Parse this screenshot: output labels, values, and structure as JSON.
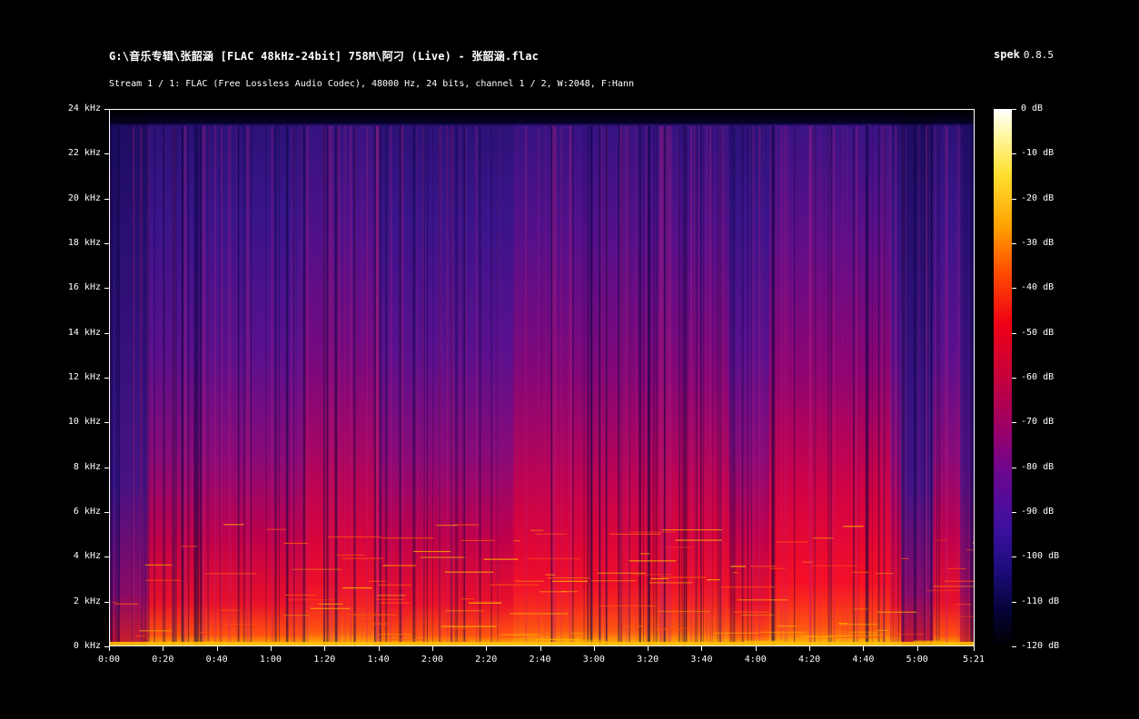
{
  "header": {
    "file_title": "G:\\音乐专辑\\张韶涵 [FLAC 48kHz-24bit] 758M\\阿刁 (Live) - 张韶涵.flac",
    "app_name": "spek",
    "app_version": "0.8.5",
    "stream_info": "Stream 1 / 1: FLAC (Free Lossless Audio Codec), 48000 Hz, 24 bits, channel 1 / 2, W:2048, F:Hann"
  },
  "spectrogram": {
    "frequency_axis": {
      "labels": [
        "0 kHz",
        "2 kHz",
        "4 kHz",
        "6 kHz",
        "8 kHz",
        "10 kHz",
        "12 kHz",
        "14 kHz",
        "16 kHz",
        "18 kHz",
        "20 kHz",
        "22 kHz",
        "24 kHz"
      ],
      "min_khz": 0,
      "max_khz": 24
    },
    "time_axis": {
      "labels": [
        "0:00",
        "0:20",
        "0:40",
        "1:00",
        "1:20",
        "1:40",
        "2:00",
        "2:20",
        "2:40",
        "3:00",
        "3:20",
        "3:40",
        "4:00",
        "4:20",
        "4:40",
        "5:00",
        "5:21"
      ],
      "duration_seconds": 321
    }
  },
  "legend": {
    "labels": [
      "0 dB",
      "-10 dB",
      "-20 dB",
      "-30 dB",
      "-40 dB",
      "-50 dB",
      "-60 dB",
      "-70 dB",
      "-80 dB",
      "-90 dB",
      "-100 dB",
      "-110 dB",
      "-120 dB"
    ],
    "min_db": -120,
    "max_db": 0
  },
  "colors": {
    "background": "#000000",
    "text": "#ffffff",
    "low_energy": "#2a0e7a",
    "mid_energy": "#b00070",
    "high_energy": "#ff1a20",
    "peak_energy": "#ffd000"
  }
}
